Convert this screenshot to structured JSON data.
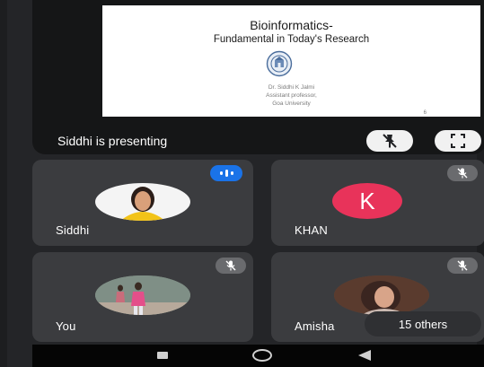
{
  "presentation": {
    "slide": {
      "title": "Bioinformatics-",
      "subtitle": "Fundamental in Today's Research",
      "presenter_name": "Dr. Siddhi K Jalmi",
      "presenter_role": "Assistant professor,",
      "presenter_affiliation": "Goa University",
      "page_number": "6"
    },
    "status_label": "Siddhi is presenting",
    "pin_icon": "pin-off-icon",
    "fullscreen_icon": "fullscreen-icon"
  },
  "participants": [
    {
      "name": "Siddhi",
      "status": "speaking",
      "avatar": "photo"
    },
    {
      "name": "KHAN",
      "status": "muted",
      "avatar_letter": "K",
      "avatar_color": "#e8335a"
    },
    {
      "name": "You",
      "status": "muted",
      "avatar": "photo"
    },
    {
      "name": "Amisha",
      "status": "muted",
      "avatar": "photo"
    }
  ],
  "others_label": "15 others",
  "colors": {
    "background": "#242528",
    "tile": "#3b3c3f",
    "speaking": "#1a73e8",
    "muted_badge": "#6a6b6e",
    "k_avatar": "#e8335a"
  },
  "navbar": {
    "icons": [
      "recents-square-icon",
      "home-circle-icon",
      "back-triangle-icon"
    ]
  }
}
